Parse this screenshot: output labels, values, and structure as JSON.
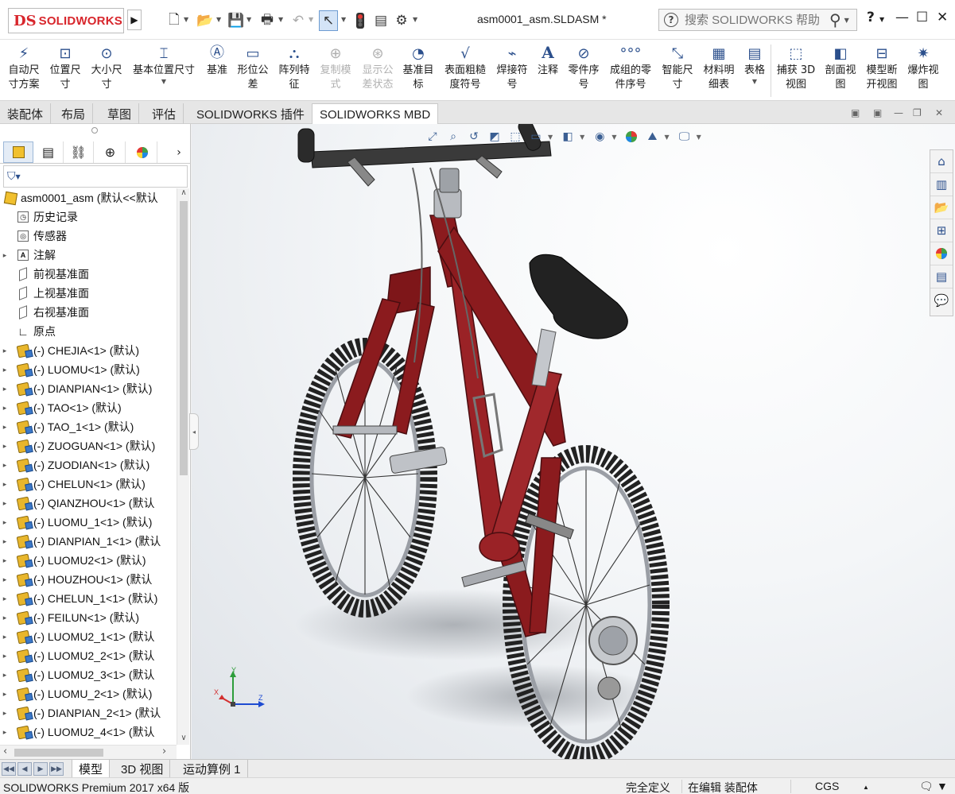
{
  "brand": {
    "mark": "DS",
    "name": "SOLIDWORKS"
  },
  "document": {
    "title": "asm0001_asm.SLDASM *"
  },
  "search": {
    "placeholder": "搜索 SOLIDWORKS 帮助"
  },
  "window_controls": {
    "help": "?",
    "minimize": "—",
    "maximize": "☐",
    "close": "✕"
  },
  "ribbon": {
    "commands": [
      {
        "label": "自动尺\n寸方案",
        "icon": "auto-dimension-icon"
      },
      {
        "label": "位置尺\n寸",
        "icon": "location-dimension-icon"
      },
      {
        "label": "大小尺\n寸",
        "icon": "size-dimension-icon"
      },
      {
        "label": "基本位置尺寸",
        "icon": "basic-location-dimension-icon"
      },
      {
        "label": "基准",
        "icon": "datum-icon"
      },
      {
        "label": "形位公\n差",
        "icon": "geometric-tolerance-icon"
      },
      {
        "label": "阵列特\n征",
        "icon": "pattern-feature-icon"
      },
      {
        "label": "复制模\n式",
        "icon": "copy-scheme-icon",
        "disabled": true
      },
      {
        "label": "显示公\n差状态",
        "icon": "show-tolerance-status-icon",
        "disabled": true
      },
      {
        "label": "基准目\n标",
        "icon": "datum-target-icon"
      },
      {
        "label": "表面粗糙\n度符号",
        "icon": "surface-finish-icon"
      },
      {
        "label": "焊接符\n号",
        "icon": "weld-symbol-icon"
      },
      {
        "label": "注释",
        "icon": "note-icon"
      },
      {
        "label": "零件序\n号",
        "icon": "balloon-icon"
      },
      {
        "label": "成组的零\n件序号",
        "icon": "stacked-balloon-icon"
      },
      {
        "label": "智能尺\n寸",
        "icon": "smart-dimension-icon"
      },
      {
        "label": "材料明\n细表",
        "icon": "bom-icon"
      },
      {
        "label": "表格",
        "icon": "table-icon"
      },
      {
        "label": "捕获 3D\n视图",
        "icon": "capture-3d-view-icon"
      },
      {
        "label": "剖面视\n图",
        "icon": "section-view-icon"
      },
      {
        "label": "模型断\n开视图",
        "icon": "model-break-view-icon"
      },
      {
        "label": "爆炸视\n图",
        "icon": "exploded-view-icon"
      }
    ]
  },
  "command_tabs": [
    "装配体",
    "布局",
    "草图",
    "评估",
    "SOLIDWORKS 插件",
    "SOLIDWORKS MBD"
  ],
  "active_command_tab": "SOLIDWORKS MBD",
  "feature_tree": {
    "root": "asm0001_asm (默认<<默认",
    "items": [
      {
        "label": "历史记录",
        "type": "history"
      },
      {
        "label": "传感器",
        "type": "sensor"
      },
      {
        "label": "注解",
        "type": "annotation",
        "expandable": true
      },
      {
        "label": "前视基准面",
        "type": "plane"
      },
      {
        "label": "上视基准面",
        "type": "plane"
      },
      {
        "label": "右视基准面",
        "type": "plane"
      },
      {
        "label": "原点",
        "type": "origin"
      },
      {
        "label": "(-) CHEJIA<1> (默认)",
        "type": "part"
      },
      {
        "label": "(-) LUOMU<1> (默认)",
        "type": "part"
      },
      {
        "label": "(-) DIANPIAN<1> (默认)",
        "type": "part"
      },
      {
        "label": "(-) TAO<1> (默认)",
        "type": "part"
      },
      {
        "label": "(-) TAO_1<1> (默认)",
        "type": "part"
      },
      {
        "label": "(-) ZUOGUAN<1> (默认)",
        "type": "part"
      },
      {
        "label": "(-) ZUODIAN<1> (默认)",
        "type": "part"
      },
      {
        "label": "(-) CHELUN<1> (默认)",
        "type": "part"
      },
      {
        "label": "(-) QIANZHOU<1> (默认",
        "type": "part"
      },
      {
        "label": "(-) LUOMU_1<1> (默认)",
        "type": "part"
      },
      {
        "label": "(-) DIANPIAN_1<1> (默认",
        "type": "part"
      },
      {
        "label": "(-) LUOMU2<1> (默认)",
        "type": "part"
      },
      {
        "label": "(-) HOUZHOU<1> (默认",
        "type": "part"
      },
      {
        "label": "(-) CHELUN_1<1> (默认)",
        "type": "part"
      },
      {
        "label": "(-) FEILUN<1> (默认)",
        "type": "part"
      },
      {
        "label": "(-) LUOMU2_1<1> (默认",
        "type": "part"
      },
      {
        "label": "(-) LUOMU2_2<1> (默认",
        "type": "part"
      },
      {
        "label": "(-) LUOMU2_3<1> (默认",
        "type": "part"
      },
      {
        "label": "(-) LUOMU_2<1> (默认)",
        "type": "part"
      },
      {
        "label": "(-) DIANPIAN_2<1> (默认",
        "type": "part"
      },
      {
        "label": "(-) LUOMU2_4<1> (默认",
        "type": "part"
      }
    ]
  },
  "bottom_tabs": [
    "模型",
    "3D 视图",
    "运动算例 1"
  ],
  "active_bottom_tab": "模型",
  "status": {
    "product": "SOLIDWORKS Premium 2017 x64 版",
    "definition": "完全定义",
    "mode": "在编辑 装配体",
    "units": "CGS"
  },
  "triad": {
    "x": "X",
    "y": "Y",
    "z": "Z"
  },
  "colors": {
    "frame": "#8b1b1e",
    "brand": "#d8262c",
    "accent": "#2b4f8c"
  }
}
